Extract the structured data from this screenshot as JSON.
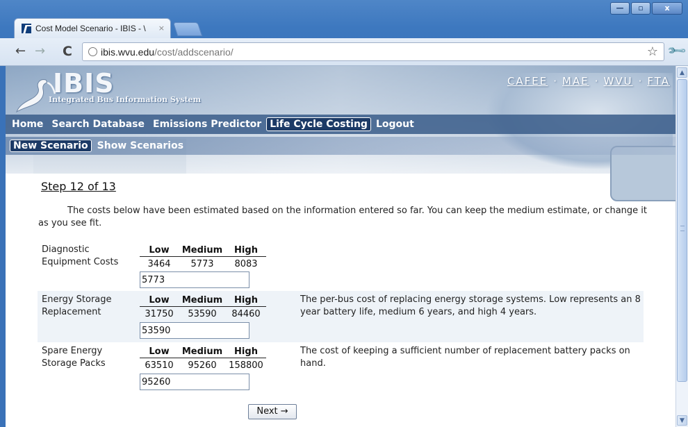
{
  "browser": {
    "tab_title": "Cost Model Scenario - IBIS - \\",
    "tab_close": "×",
    "url_host": "ibis.wvu.edu",
    "url_path": "/cost/addscenario/",
    "window_buttons": {
      "minimize": "—",
      "maximize": "▫",
      "close": "x"
    }
  },
  "site": {
    "logo_text": "IBIS",
    "logo_subtitle": "Integrated Bus Information System",
    "top_links": [
      "CAFEE",
      "MAE",
      "WVU",
      "FTA"
    ],
    "top_sep": "·"
  },
  "nav": {
    "items": [
      "Home",
      "Search Database",
      "Emissions Predictor",
      "Life Cycle Costing",
      "Logout"
    ],
    "active": "Life Cycle Costing"
  },
  "subnav": {
    "items": [
      "New Scenario",
      "Show Scenarios"
    ],
    "active": "New Scenario"
  },
  "content": {
    "step": "Step 12 of 13",
    "intro": "The costs below have been estimated based on the information entered so far. You can keep the medium estimate, or change it as you see fit.",
    "col_headers": {
      "low": "Low",
      "medium": "Medium",
      "high": "High"
    },
    "rows": [
      {
        "label": "Diagnostic Equipment Costs",
        "low": "3464",
        "medium": "5773",
        "high": "8083",
        "input_value": "5773",
        "description": ""
      },
      {
        "label": "Energy Storage Replacement",
        "low": "31750",
        "medium": "53590",
        "high": "84460",
        "input_value": "53590",
        "description": "The per-bus cost of replacing energy storage systems. Low represents an 8 year battery life, medium 6 years, and high 4 years."
      },
      {
        "label": "Spare Energy Storage Packs",
        "low": "63510",
        "medium": "95260",
        "high": "158800",
        "input_value": "95260",
        "description": "The cost of keeping a sufficient number of replacement battery packs on hand."
      }
    ],
    "next_button": "Next →"
  },
  "colors": {
    "nav_bar": "#3e608c",
    "active_nav": "#1c3a66",
    "shaded_row": "#eef3f8",
    "chrome": "#3d78bf"
  }
}
